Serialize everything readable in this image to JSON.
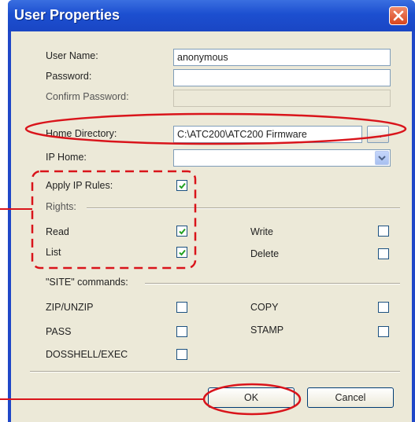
{
  "window": {
    "title": "User Properties"
  },
  "fields": {
    "user_name": {
      "label": "User Name:",
      "value": "anonymous"
    },
    "password": {
      "label": "Password:",
      "value": ""
    },
    "confirm_password": {
      "label": "Confirm Password:",
      "value": ""
    },
    "home_directory": {
      "label": "Home Directory:",
      "value": "C:\\ATC200\\ATC200 Firmware",
      "browse_label": "..."
    },
    "ip_home": {
      "label": "IP Home:",
      "value": ""
    }
  },
  "apply_ip_rules": {
    "label": "Apply IP Rules:",
    "checked": true
  },
  "rights": {
    "heading": "Rights:",
    "read": {
      "label": "Read",
      "checked": true
    },
    "write": {
      "label": "Write",
      "checked": false
    },
    "list": {
      "label": "List",
      "checked": true
    },
    "delete": {
      "label": "Delete",
      "checked": false
    }
  },
  "site_commands": {
    "heading": "\"SITE\" commands:",
    "zip_unzip": {
      "label": "ZIP/UNZIP",
      "checked": false
    },
    "copy": {
      "label": "COPY",
      "checked": false
    },
    "pass": {
      "label": "PASS",
      "checked": false
    },
    "stamp": {
      "label": "STAMP",
      "checked": false
    },
    "dosshell_exec": {
      "label": "DOSSHELL/EXEC",
      "checked": false
    }
  },
  "buttons": {
    "ok": "OK",
    "cancel": "Cancel"
  },
  "colors": {
    "title_bar": "#1f47c8",
    "dialog_face": "#ece9d8",
    "annotation": "#d9141b"
  }
}
